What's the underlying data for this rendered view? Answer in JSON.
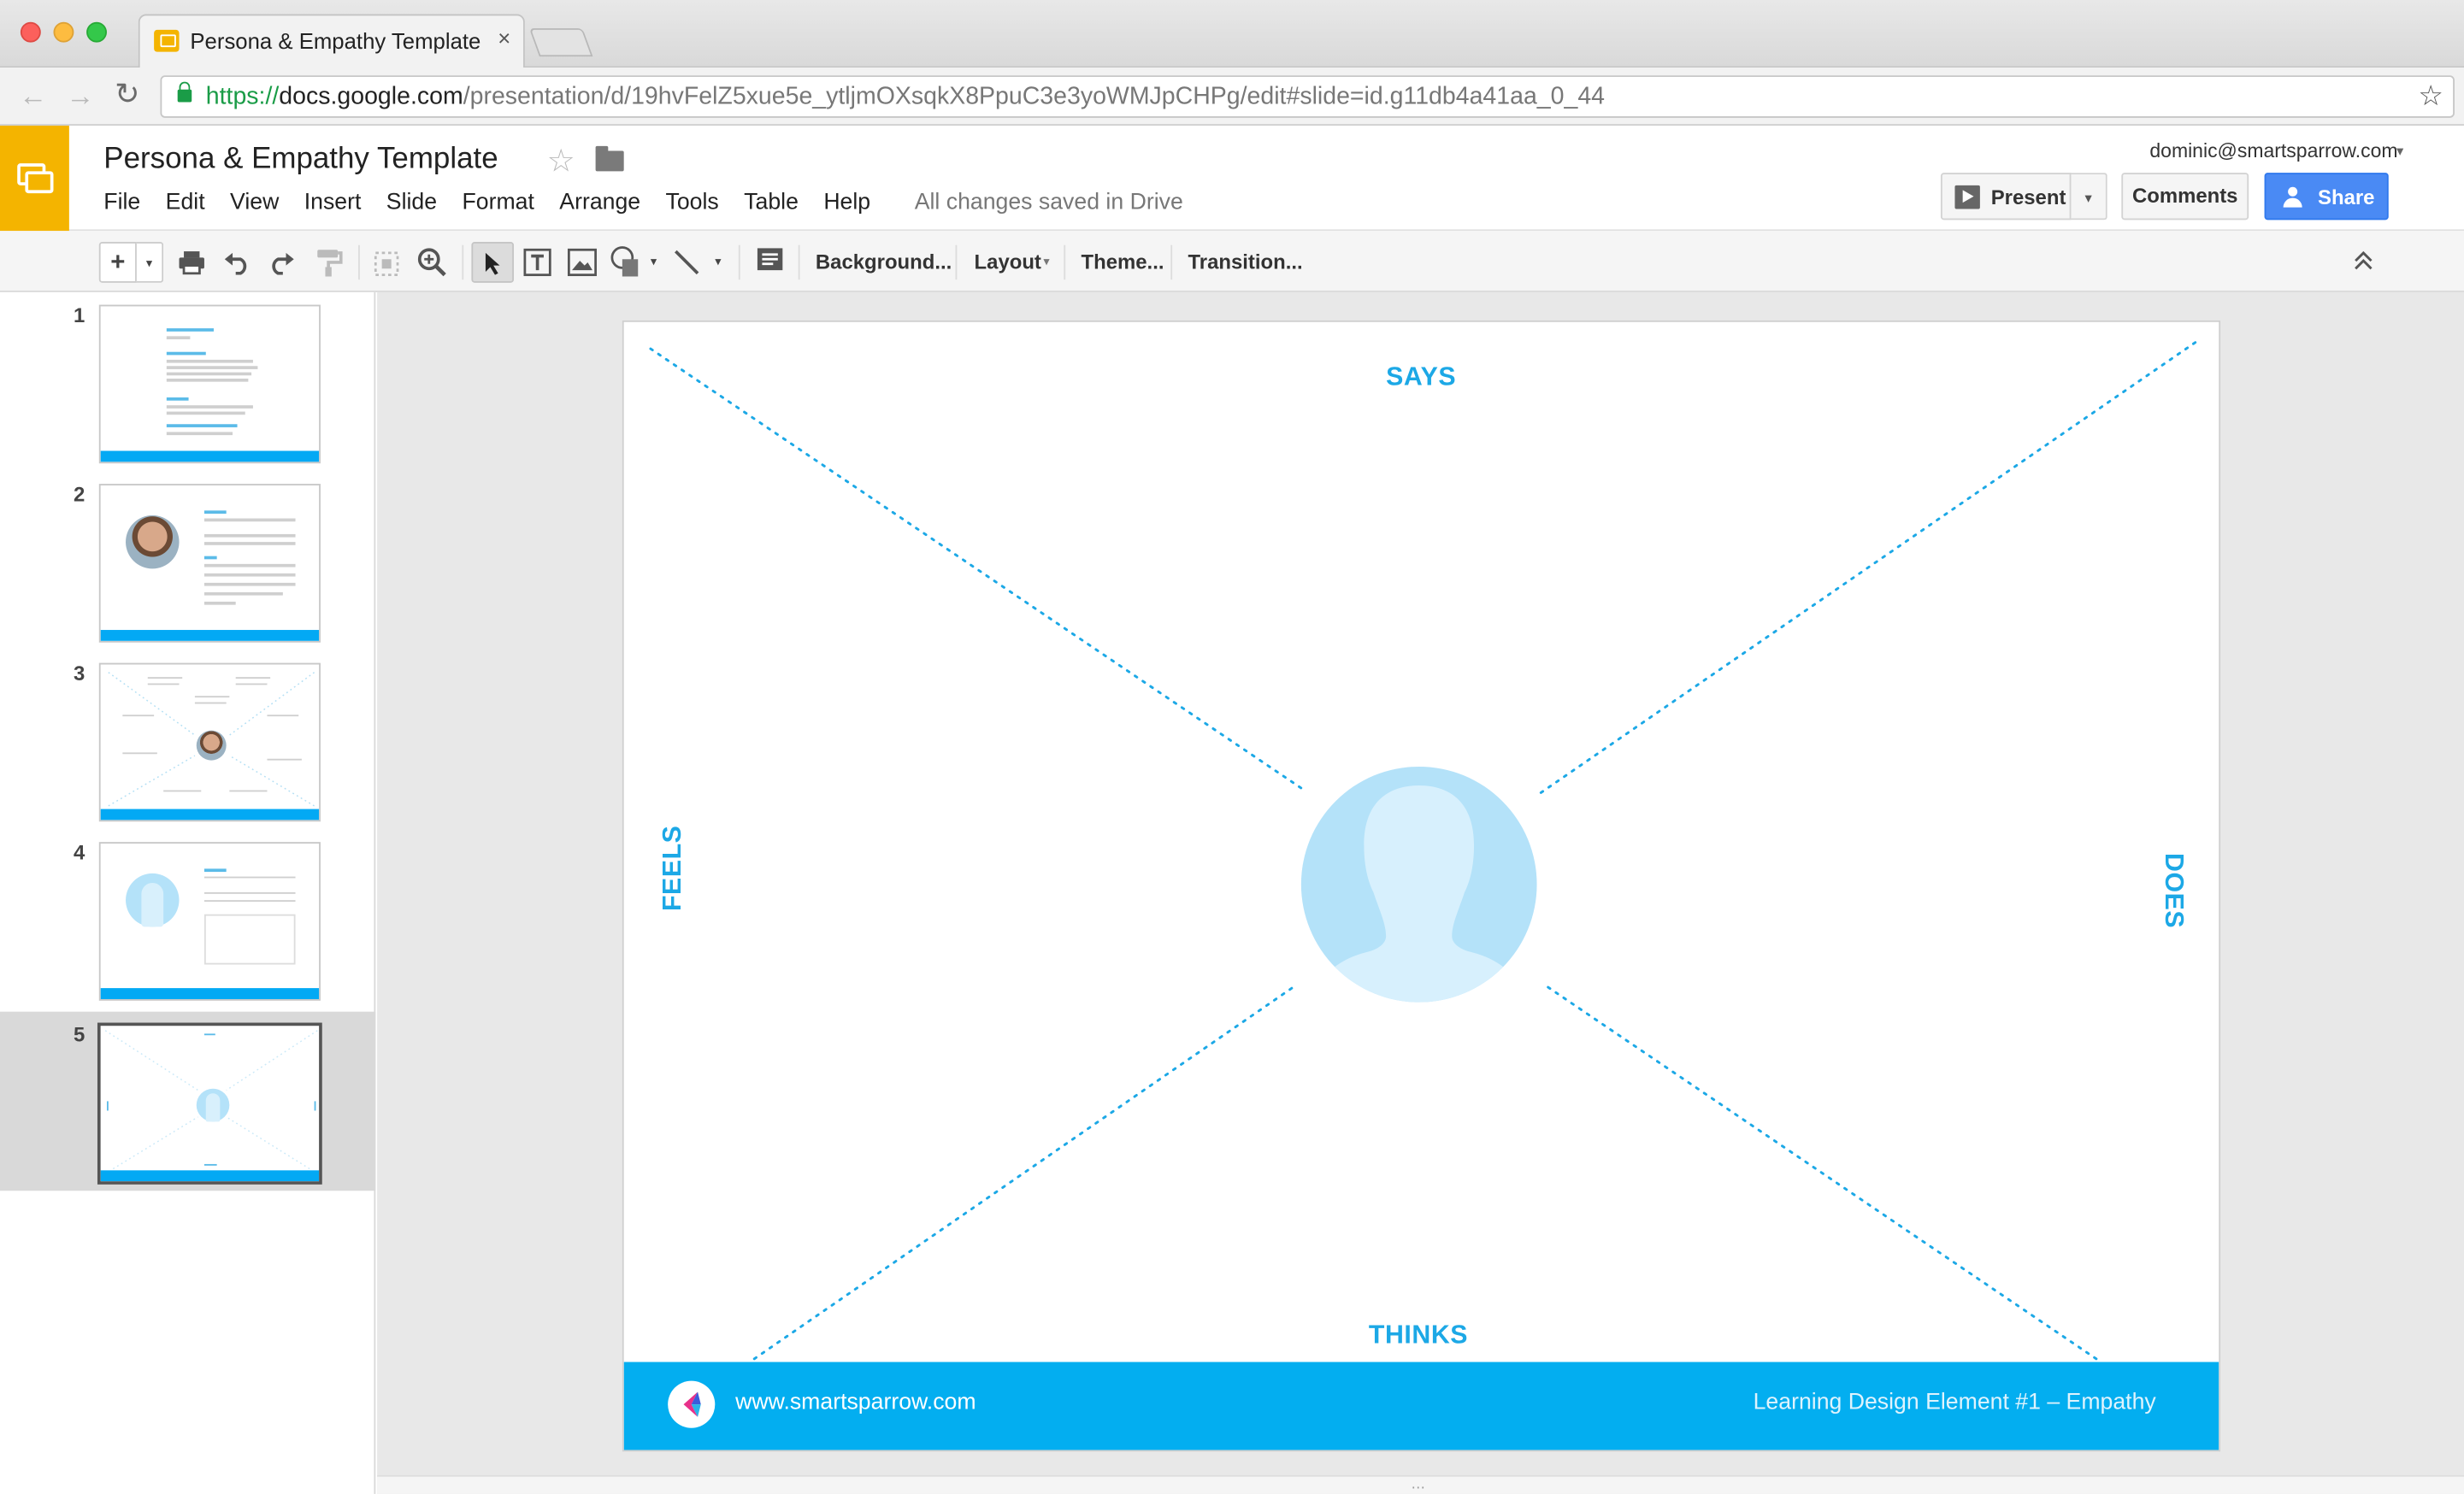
{
  "browser": {
    "tab_title": "Persona & Empathy Template",
    "tab_close": "×",
    "url_scheme": "https://",
    "url_host": "docs.google.com",
    "url_path": "/presentation/d/19hvFelZ5xue5e_ytljmOXsqkX8PpuC3e3yoWMJpCHPg/edit#slide=id.g11db4a41aa_0_44",
    "back_icon": "←",
    "forward_icon": "→",
    "reload_icon": "↻",
    "bookmark_icon": "☆"
  },
  "docs": {
    "title": "Persona & Empathy Template",
    "star_icon": "☆",
    "menus": [
      "File",
      "Edit",
      "View",
      "Insert",
      "Slide",
      "Format",
      "Arrange",
      "Tools",
      "Table",
      "Help"
    ],
    "save_status": "All changes saved in Drive",
    "user_email": "dominic@smartsparrow.com",
    "user_caret": "▾",
    "present_label": "Present",
    "present_caret": "▾",
    "comments_label": "Comments",
    "share_label": "Share"
  },
  "toolbar": {
    "new_slide": "+",
    "new_slide_caret": "▾",
    "background": "Background...",
    "layout": "Layout",
    "layout_caret": "▾",
    "theme": "Theme...",
    "transition": "Transition...",
    "collapse_icon": "⌃"
  },
  "filmstrip": {
    "slides": [
      {
        "number": "1"
      },
      {
        "number": "2"
      },
      {
        "number": "3"
      },
      {
        "number": "4"
      },
      {
        "number": "5",
        "selected": true
      }
    ]
  },
  "slide": {
    "says": "SAYS",
    "thinks": "THINKS",
    "feels": "FEELS",
    "does": "DOES",
    "footer_url": "www.smartsparrow.com",
    "footer_right": "Learning Design Element #1 – Empathy",
    "accent_color": "#03aef0",
    "label_color": "#1ca8e6"
  },
  "canvas": {
    "grip": "⋯"
  }
}
